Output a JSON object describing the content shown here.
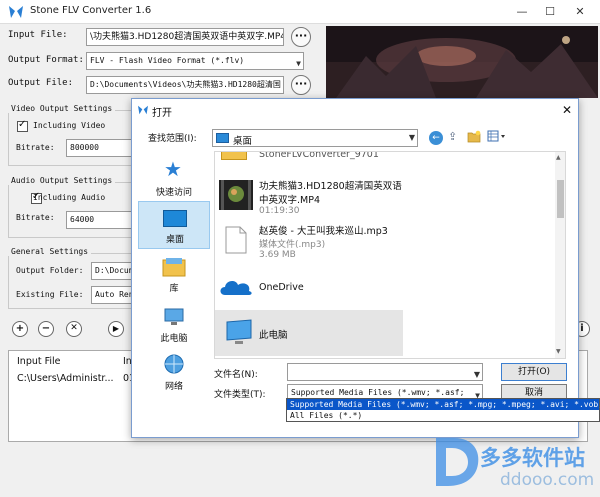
{
  "app": {
    "title": "Stone FLV Converter 1.6",
    "minimize": "—",
    "maximize": "☐",
    "close": "✕"
  },
  "form": {
    "input_file_label": "Input File:",
    "input_file_value": "\\功夫熊猫3.HD1280超清国英双语中英双字.MP4",
    "output_format_label": "Output Format:",
    "output_format_value": "FLV - Flash Video Format (*.flv)",
    "output_file_label": "Output File:",
    "output_file_value": "D:\\Documents\\Videos\\功夫熊猫3.HD1280超清国",
    "browse_label": "···"
  },
  "video_settings": {
    "title": "Video Output Settings",
    "include_label": "Including Video",
    "bitrate_label": "Bitrate:",
    "bitrate_value": "800000"
  },
  "audio_settings": {
    "title": "Audio Output Settings",
    "include_label": "Including Audio",
    "bitrate_label": "Bitrate:",
    "bitrate_value": "64000"
  },
  "general_settings": {
    "title": "General Settings",
    "output_folder_label": "Output Folder:",
    "output_folder_value": "D:\\Docum",
    "existing_file_label": "Existing File:",
    "existing_file_value": "Auto Ren"
  },
  "toolbar": {
    "add": "+",
    "remove": "−",
    "clear": "✕",
    "play": "▶",
    "info": "i"
  },
  "queue": {
    "columns": [
      "Input File",
      "In"
    ],
    "rows": [
      {
        "input": "C:\\Users\\Administr...",
        "second": "01"
      }
    ]
  },
  "dialog": {
    "title": "打开",
    "lookin_label": "查找范围(I):",
    "lookin_value": "桌面",
    "places": [
      {
        "label": "快速访问",
        "icon": "star-icon"
      },
      {
        "label": "桌面",
        "icon": "desktop-icon"
      },
      {
        "label": "库",
        "icon": "library-icon"
      },
      {
        "label": "此电脑",
        "icon": "computer-icon"
      },
      {
        "label": "网络",
        "icon": "network-icon"
      }
    ],
    "files": [
      {
        "name": "StoneFLVConverter_9701",
        "sub": "",
        "icon": "folder-icon"
      },
      {
        "name": "功夫熊猫3.HD1280超清国英双语",
        "name2": "中英双字.MP4",
        "sub": "01:19:30",
        "icon": "video-thumb-icon"
      },
      {
        "name": "赵英俊 - 大王叫我来巡山.mp3",
        "sub": "媒体文件(.mp3)",
        "sub2": "3.69 MB",
        "icon": "audio-file-icon"
      },
      {
        "name": "OneDrive",
        "sub": "",
        "icon": "onedrive-icon"
      },
      {
        "name": "此电脑",
        "sub": "",
        "icon": "computer-icon"
      }
    ],
    "filename_label": "文件名(N):",
    "filename_value": "",
    "filetype_label": "文件类型(T):",
    "filetype_value": "Supported Media Files (*.wmv; *.asf;",
    "filetype_options": [
      "Supported Media Files (*.wmv; *.asf; *.mpg; *.mpeg; *.avi; *.vob;",
      "All Files (*.*)"
    ],
    "open_button": "打开(O)",
    "cancel_button": "取消",
    "close": "✕"
  },
  "watermark": {
    "text": "多多软件站",
    "url": "ddooo.com"
  },
  "colors": {
    "accent": "#0a56c9",
    "selection_bg": "#cde6f7",
    "dialog_border": "#7a9ccf"
  }
}
